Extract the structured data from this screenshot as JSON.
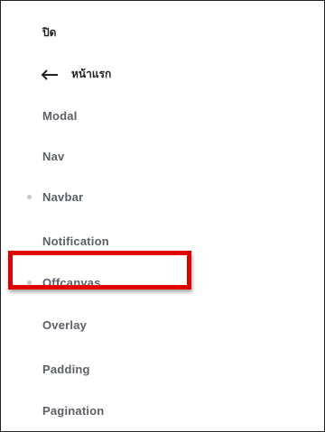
{
  "menu": {
    "close_label": "ปิด",
    "back_label": "หน้าแรก",
    "items": [
      {
        "label": "Modal",
        "bullet": false
      },
      {
        "label": "Nav",
        "bullet": false
      },
      {
        "label": "Navbar",
        "bullet": true
      },
      {
        "label": "Notification",
        "bullet": false
      },
      {
        "label": "Offcanvas",
        "bullet": true
      },
      {
        "label": "Overlay",
        "bullet": false
      },
      {
        "label": "Padding",
        "bullet": false
      },
      {
        "label": "Pagination",
        "bullet": false
      }
    ]
  },
  "colors": {
    "highlight": "#e00000",
    "item_text": "#5b6068",
    "bullet": "#c4c8cc"
  }
}
